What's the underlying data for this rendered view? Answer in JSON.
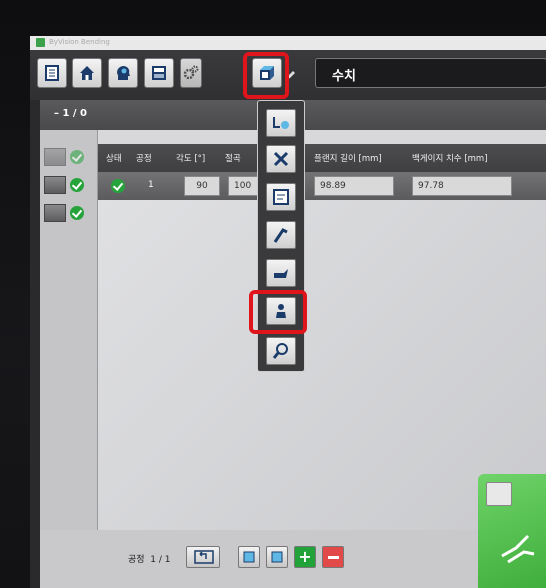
{
  "window": {
    "title": "ByVision Bending"
  },
  "toolbar": {
    "field_label": "수치"
  },
  "progress": {
    "text": "– 1 / 0"
  },
  "table": {
    "headers": [
      "상태",
      "공정",
      "각도 [°]",
      "절곡",
      "플랜지 길이 [mm]",
      "백게이지 치수 [mm]"
    ],
    "rows": [
      {
        "step": "1",
        "angle": "90",
        "bend": "100",
        "flange": "98.89",
        "backgauge": "97.78"
      }
    ]
  },
  "footer": {
    "step_label": "공정",
    "step_count": "1 / 1"
  },
  "colors": {
    "accent_red": "#e0141b",
    "check_green": "#26a33b",
    "panel_green": "#4fbf4a"
  }
}
